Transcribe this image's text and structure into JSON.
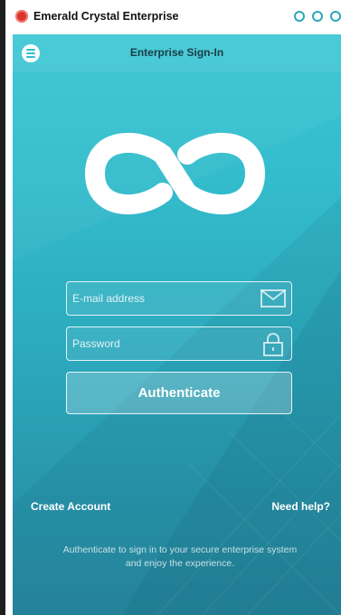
{
  "window": {
    "title": "Emerald Crystal Enterprise",
    "app_icon": "app-badge-icon",
    "controls": [
      "circle-icon",
      "circle-icon",
      "circle-icon"
    ]
  },
  "header": {
    "menu_icon": "hamburger-menu-icon",
    "title": "Enterprise Sign-In"
  },
  "login": {
    "logo_icon": "infinity-logo-icon",
    "email_placeholder": "E-mail address",
    "email_icon": "envelope-icon",
    "password_placeholder": "Password",
    "password_icon": "lock-icon",
    "submit_label": "Authenticate"
  },
  "links": {
    "create_account": "Create Account",
    "need_help": "Need help?"
  },
  "footer": {
    "message": "Authenticate to sign in to your secure enterprise system and enjoy the experience."
  },
  "colors": {
    "accent": "#39c6d4",
    "accent_dark": "#27889f",
    "title_text": "#1b3d46",
    "window_control": "#2ba7b9",
    "app_icon": "#d9342b"
  }
}
